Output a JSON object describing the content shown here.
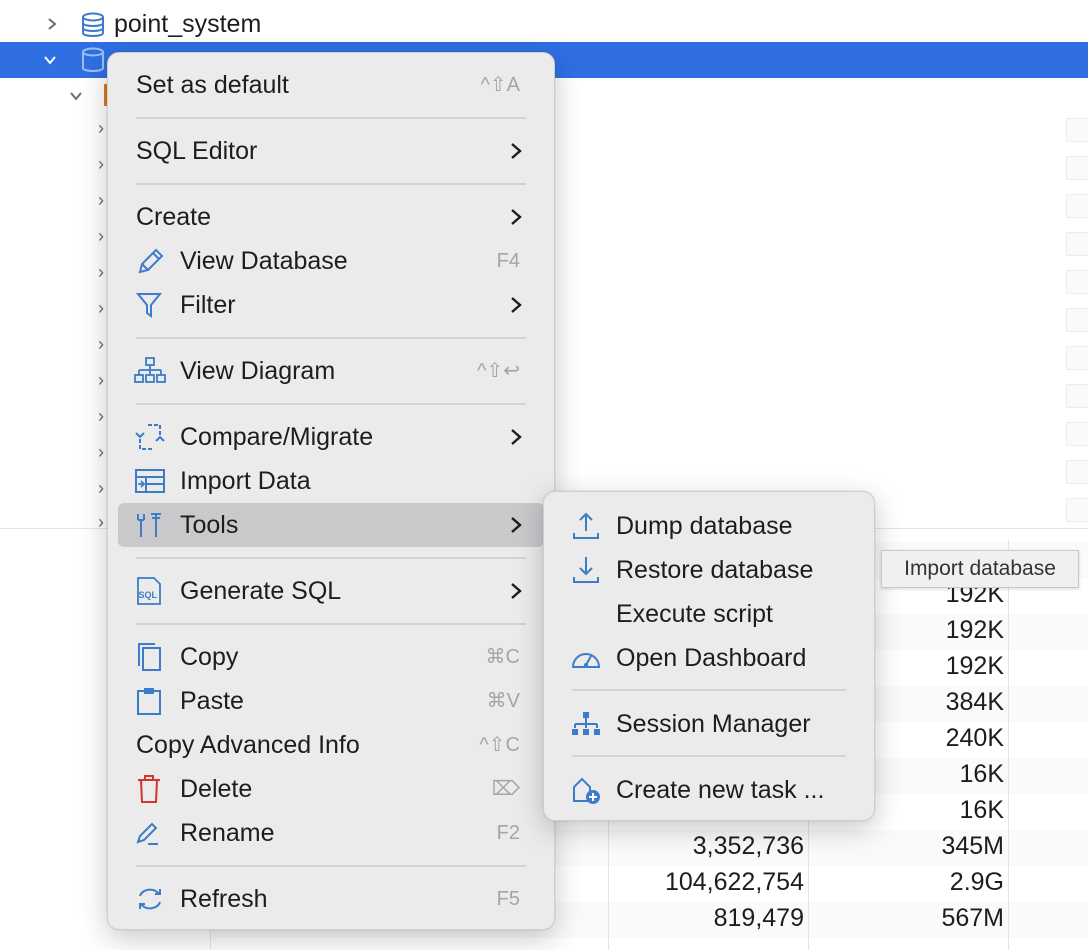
{
  "tree": {
    "db1_label": "point_system"
  },
  "table_values": [
    {
      "rows": "",
      "size": "192K"
    },
    {
      "rows": "",
      "size": "192K"
    },
    {
      "rows": "",
      "size": "192K"
    },
    {
      "rows": "",
      "size": "384K"
    },
    {
      "rows": "",
      "size": "240K"
    },
    {
      "rows": "",
      "size": "16K"
    },
    {
      "rows": "",
      "size": "16K"
    },
    {
      "rows": "3,352,736",
      "size": "345M"
    },
    {
      "rows": "104,622,754",
      "size": "2.9G"
    },
    {
      "rows": "819,479",
      "size": "567M"
    }
  ],
  "context_menu": {
    "set_default": {
      "label": "Set as default",
      "shortcut": "^⇧A"
    },
    "sql_editor": {
      "label": "SQL Editor"
    },
    "create": {
      "label": "Create"
    },
    "view_database": {
      "label": "View Database",
      "shortcut": "F4"
    },
    "filter": {
      "label": "Filter"
    },
    "view_diagram": {
      "label": "View Diagram",
      "shortcut": "^⇧↩"
    },
    "compare_migrate": {
      "label": "Compare/Migrate"
    },
    "import_data": {
      "label": "Import Data"
    },
    "tools": {
      "label": "Tools"
    },
    "generate_sql": {
      "label": "Generate SQL"
    },
    "copy": {
      "label": "Copy",
      "shortcut": "⌘C"
    },
    "paste": {
      "label": "Paste",
      "shortcut": "⌘V"
    },
    "copy_advanced": {
      "label": "Copy Advanced Info",
      "shortcut": "^⇧C"
    },
    "delete": {
      "label": "Delete",
      "shortcut": "⌦"
    },
    "rename": {
      "label": "Rename",
      "shortcut": "F2"
    },
    "refresh": {
      "label": "Refresh",
      "shortcut": "F5"
    }
  },
  "tools_submenu": {
    "dump": "Dump database",
    "restore": "Restore database",
    "execute": "Execute script",
    "dashboard": "Open Dashboard",
    "session": "Session Manager",
    "task": "Create new task ..."
  },
  "tooltip": "Import database",
  "colors": {
    "selection": "#2f6fe3",
    "icon_blue": "#3d7cc9",
    "delete_red": "#d2352b",
    "menu_bg": "#ebebeb"
  }
}
